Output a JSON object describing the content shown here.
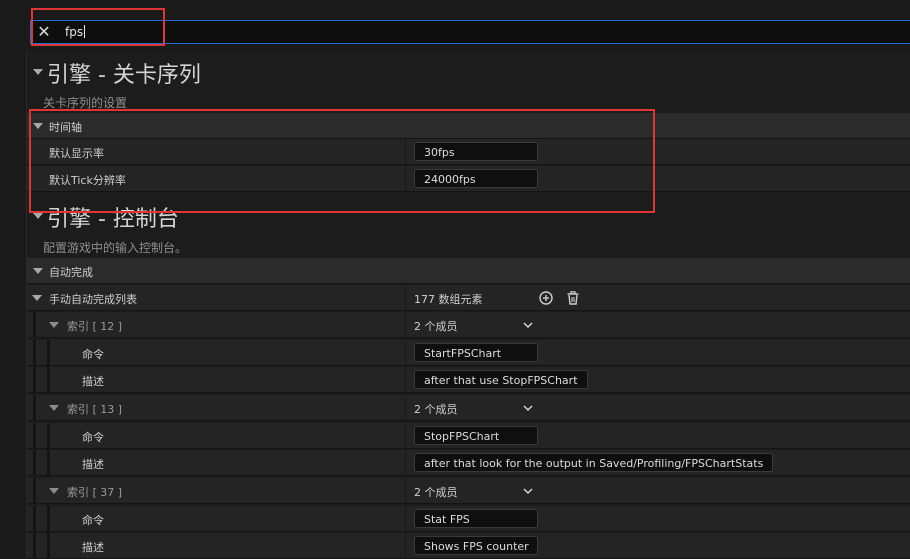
{
  "search": {
    "value": "fps"
  },
  "sections": [
    {
      "title": "引擎 - 关卡序列",
      "description": "关卡序列的设置",
      "category": "时间轴",
      "properties": [
        {
          "label": "默认显示率",
          "value": "30fps"
        },
        {
          "label": "默认Tick分辨率",
          "value": "24000fps"
        }
      ]
    },
    {
      "title": "引擎 - 控制台",
      "description": "配置游戏中的输入控制台。",
      "category": "自动完成",
      "array": {
        "label": "手动自动完成列表",
        "count_text": "177 数组元素",
        "items": [
          {
            "index_label": "索引 [ 12 ]",
            "members": "2 个成员",
            "command_label": "命令",
            "command": "StartFPSChart",
            "desc_label": "描述",
            "desc": "after that use StopFPSChart"
          },
          {
            "index_label": "索引 [ 13 ]",
            "members": "2 个成员",
            "command_label": "命令",
            "command": "StopFPSChart",
            "desc_label": "描述",
            "desc": "after that look for the output in Saved/Profiling/FPSChartStats"
          },
          {
            "index_label": "索引 [ 37 ]",
            "members": "2 个成员",
            "command_label": "命令",
            "command": "Stat FPS",
            "desc_label": "描述",
            "desc": "Shows FPS counter"
          }
        ]
      }
    }
  ],
  "colors": {
    "highlight": "#e03535",
    "focus": "#1f6fd6"
  }
}
